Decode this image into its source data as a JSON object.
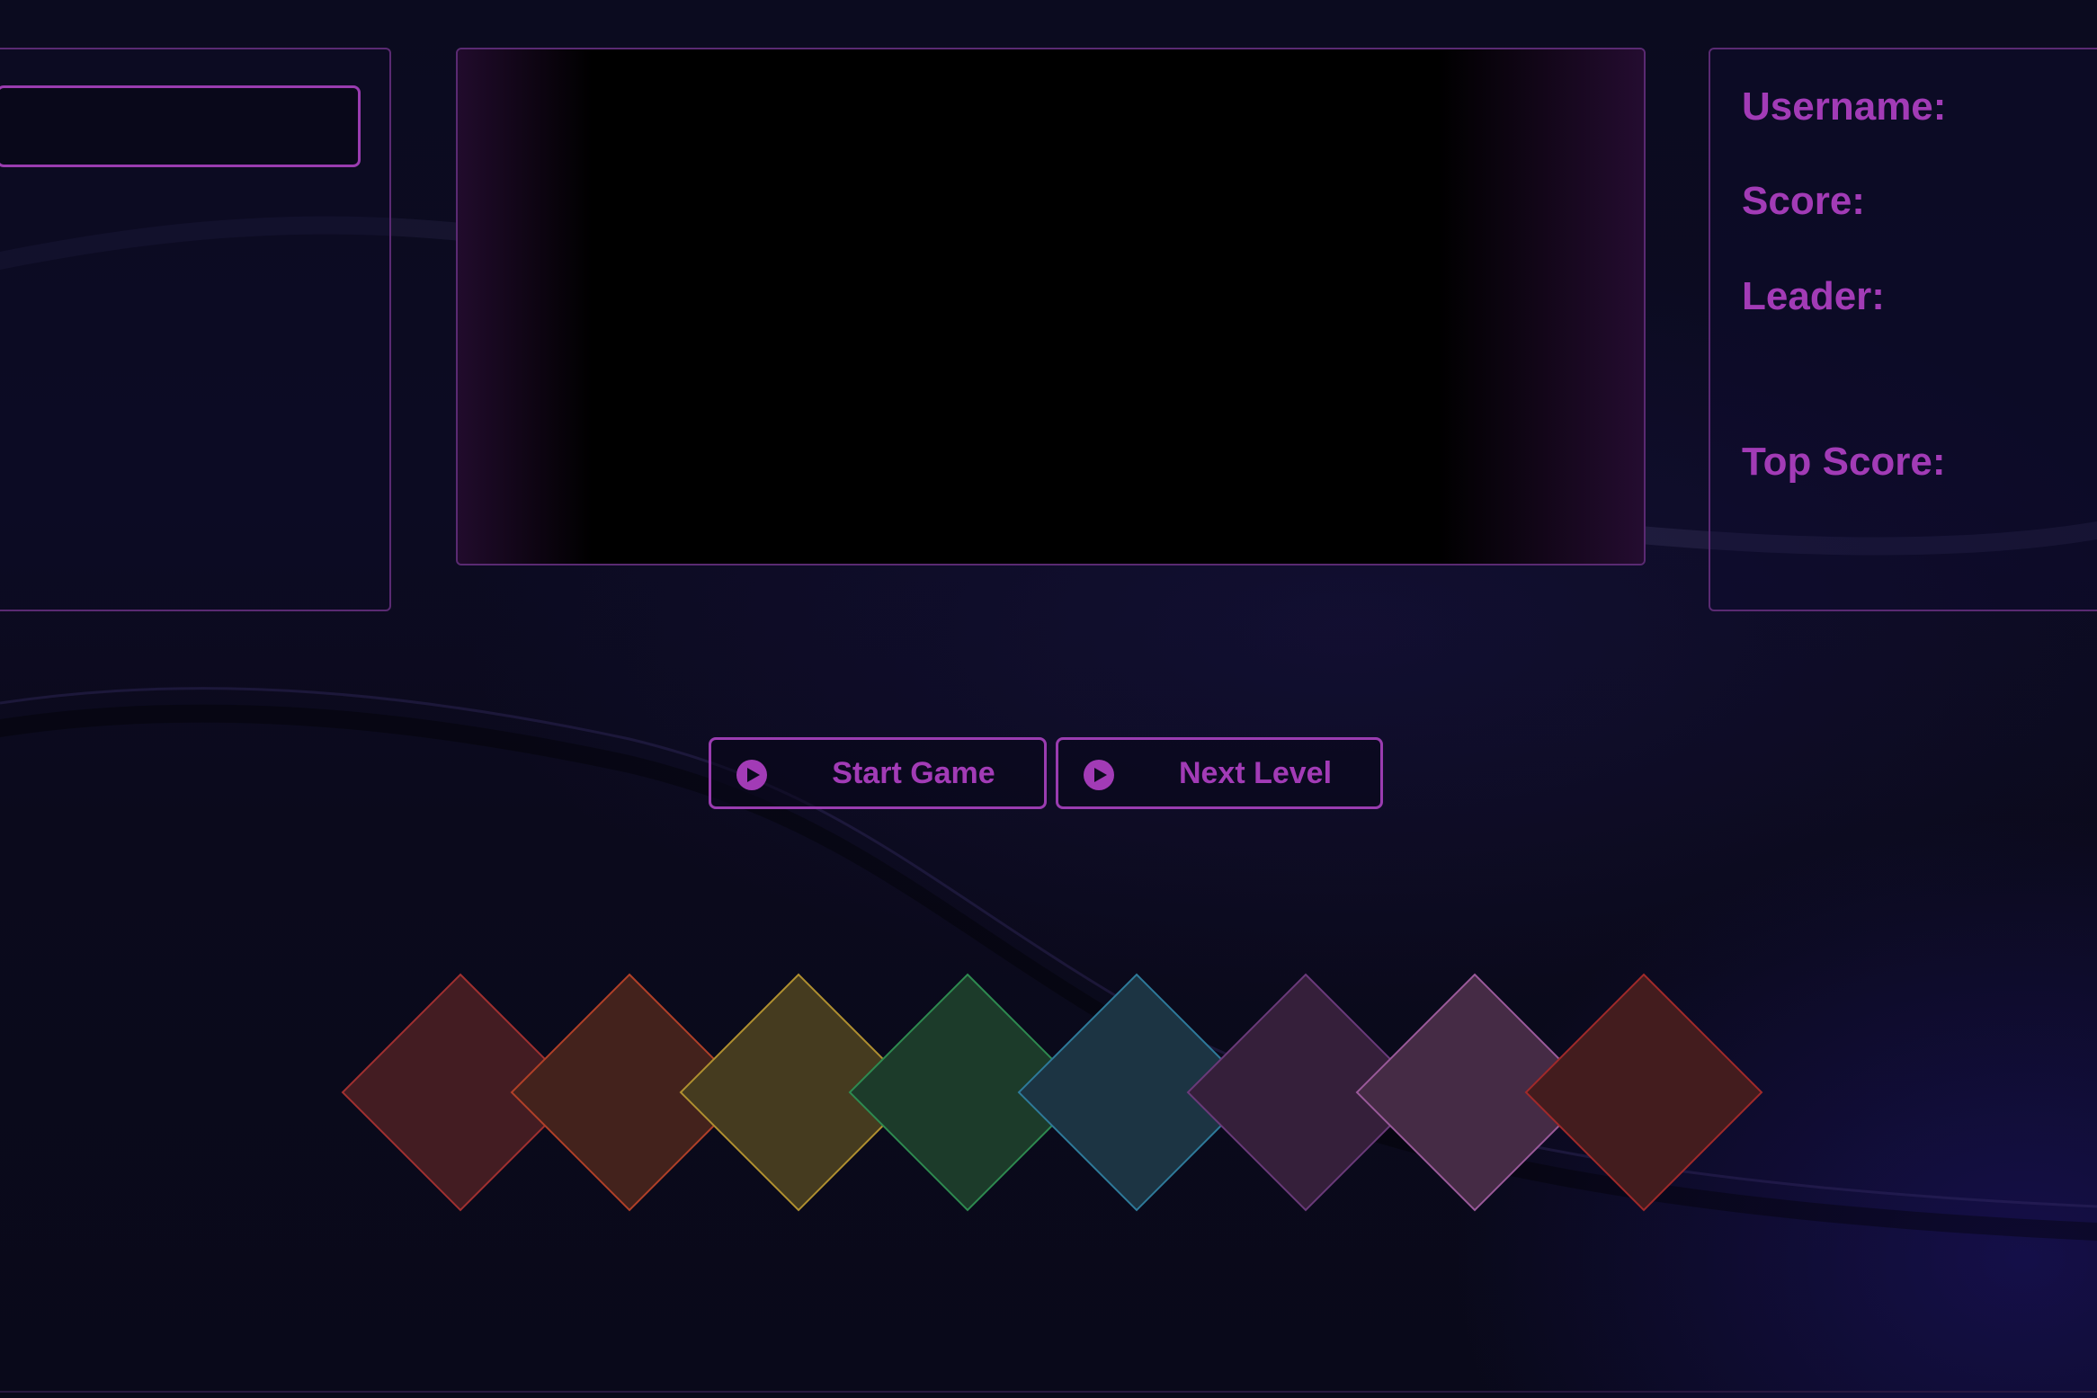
{
  "player_panel": {
    "name_input_value": "",
    "name_input_placeholder": ""
  },
  "stats": {
    "username_label": "Username:",
    "score_label": "Score:",
    "leader_label": "Leader:",
    "top_score_label": "Top Score:"
  },
  "controls": {
    "start_label": "Start Game",
    "start_icon": "play-circle-icon",
    "next_label": "Next Level",
    "next_icon": "play-circle-icon"
  },
  "pads": [
    {
      "id": "red",
      "fill": "#431c22",
      "stroke": "#a03030"
    },
    {
      "id": "orange",
      "fill": "#43221c",
      "stroke": "#b04028"
    },
    {
      "id": "yellow",
      "fill": "#453b1f",
      "stroke": "#b09030"
    },
    {
      "id": "green",
      "fill": "#1c3b2a",
      "stroke": "#2e8a50"
    },
    {
      "id": "blue",
      "fill": "#1c3443",
      "stroke": "#2e7a9a"
    },
    {
      "id": "purple",
      "fill": "#351f3a",
      "stroke": "#6a3a7a"
    },
    {
      "id": "pink",
      "fill": "#452b45",
      "stroke": "#9a5a9a"
    },
    {
      "id": "crimson",
      "fill": "#431c1e",
      "stroke": "#a02a2a"
    }
  ],
  "theme": {
    "accent": "#a23bb6",
    "panel_border": "#5a2a72",
    "background": "#0a0a1a"
  }
}
